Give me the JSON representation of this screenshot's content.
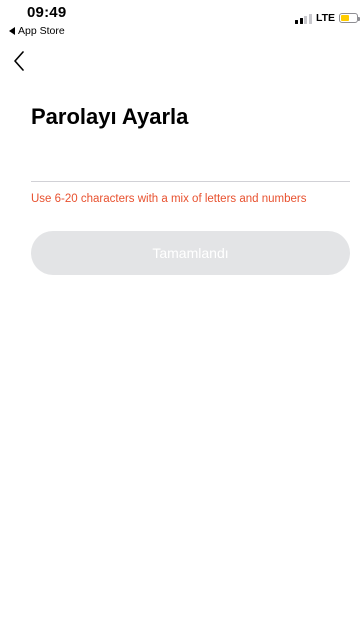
{
  "status_bar": {
    "time": "09:49",
    "back_app_label": "App Store",
    "network": "LTE",
    "signal_bars_active": 2,
    "signal_bars_total": 4,
    "battery_level": 0.55,
    "battery_color": "#ffcc00"
  },
  "nav": {
    "back_icon": "chevron-left-icon"
  },
  "page": {
    "title": "Parolayı Ayarla",
    "password_placeholder": "",
    "password_value": "",
    "hint": "Use 6-20 characters with a mix of letters and numbers",
    "hint_color": "#e8512f",
    "done_label": "Tamamlandı",
    "done_disabled": true,
    "done_bg_color": "#e3e4e6",
    "done_text_color": "#ffffff"
  }
}
